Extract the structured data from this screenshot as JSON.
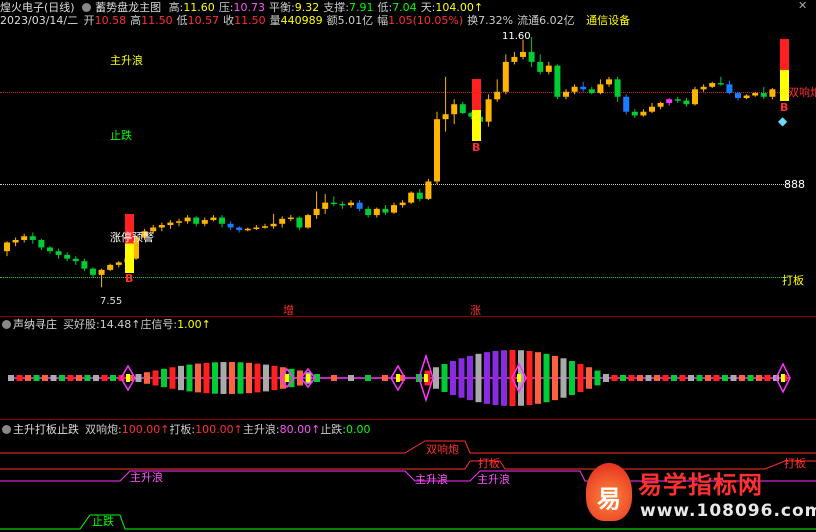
{
  "header": {
    "stock": "煌火电子(日线)",
    "indicator": "蓄势盘龙主图",
    "fields": [
      {
        "k": "高:",
        "v": "11.60",
        "c": "#ffff00"
      },
      {
        "k": "压:",
        "v": "10.73",
        "c": "#ff55ff"
      },
      {
        "k": "平衡:",
        "v": "9.32",
        "c": "#ffff00"
      },
      {
        "k": "支撑:",
        "v": "7.91",
        "c": "#00ff00"
      },
      {
        "k": "低:",
        "v": "7.04",
        "c": "#00ff00"
      },
      {
        "k": "天:",
        "v": "104.00↑",
        "c": "#ffff00"
      }
    ]
  },
  "header2": {
    "date": "2023/03/14/二",
    "fields": [
      {
        "k": "开",
        "v": "10.58",
        "c": "#ff3030"
      },
      {
        "k": "高",
        "v": "11.50",
        "c": "#ff3030"
      },
      {
        "k": "低",
        "v": "10.57",
        "c": "#ff3030"
      },
      {
        "k": "收",
        "v": "11.50",
        "c": "#ff3030"
      },
      {
        "k": "量",
        "v": "440989",
        "c": "#ffff00"
      },
      {
        "k": "额",
        "v": "5.01亿",
        "c": "#cccccc"
      },
      {
        "k": "幅",
        "v": "1.05(10.05%)",
        "c": "#ff3030"
      },
      {
        "k": "换",
        "v": "7.32%",
        "c": "#cccccc"
      },
      {
        "k": "流通",
        "v": "6.02亿",
        "c": "#cccccc"
      }
    ],
    "sector": "通信设备"
  },
  "main": {
    "labels": {
      "zhushenglang": "主升浪",
      "zhidie": "止跌",
      "zhangting": "涨停预警",
      "shuangxiangpao": "双响炮",
      "price888": "888",
      "daban": "打板",
      "high_mark": "11.60",
      "low_mark": "7.55",
      "zeng": "增",
      "zhang": "涨",
      "b": "B"
    },
    "candles": [
      [
        9.0,
        9.35,
        8.8,
        9.4
      ],
      [
        9.35,
        9.45,
        9.2,
        9.55
      ],
      [
        9.45,
        9.6,
        9.35,
        9.7
      ],
      [
        9.6,
        9.45,
        9.3,
        9.75
      ],
      [
        9.45,
        9.15,
        9.05,
        9.5
      ],
      [
        9.15,
        9.0,
        8.9,
        9.2
      ],
      [
        9.0,
        8.85,
        8.7,
        9.1
      ],
      [
        8.85,
        8.7,
        8.6,
        8.95
      ],
      [
        8.7,
        8.6,
        8.45,
        8.8
      ],
      [
        8.6,
        8.3,
        8.2,
        8.7
      ],
      [
        8.3,
        8.05,
        7.95,
        8.35
      ],
      [
        8.05,
        8.25,
        7.55,
        8.3
      ],
      [
        8.25,
        8.45,
        8.2,
        8.5
      ],
      [
        8.45,
        8.55,
        8.35,
        8.6
      ],
      [
        8.55,
        8.7,
        8.45,
        8.8
      ],
      [
        8.7,
        9.55,
        8.65,
        9.6
      ],
      [
        9.55,
        9.8,
        9.45,
        9.9
      ],
      [
        9.8,
        9.95,
        9.7,
        10.05
      ],
      [
        9.95,
        10.05,
        9.8,
        10.15
      ],
      [
        10.05,
        10.15,
        9.9,
        10.25
      ],
      [
        10.15,
        10.2,
        10.0,
        10.3
      ],
      [
        10.2,
        10.35,
        10.1,
        10.45
      ],
      [
        10.35,
        10.1,
        10.0,
        10.4
      ],
      [
        10.1,
        10.25,
        10.0,
        10.35
      ],
      [
        10.25,
        10.35,
        10.2,
        10.45
      ],
      [
        10.35,
        10.1,
        9.95,
        10.45
      ],
      [
        10.1,
        9.95,
        9.85,
        10.2
      ],
      [
        9.95,
        9.85,
        9.75,
        10.0
      ],
      [
        9.85,
        9.9,
        9.8,
        9.95
      ],
      [
        9.9,
        9.95,
        9.85,
        10.05
      ],
      [
        9.95,
        10.0,
        9.9,
        10.1
      ],
      [
        10.0,
        10.1,
        9.9,
        10.5
      ],
      [
        10.1,
        10.3,
        9.95,
        10.4
      ],
      [
        10.3,
        10.35,
        10.2,
        10.45
      ],
      [
        10.35,
        9.95,
        9.85,
        10.4
      ],
      [
        9.95,
        10.45,
        9.9,
        10.5
      ],
      [
        10.45,
        10.7,
        10.3,
        11.4
      ],
      [
        10.7,
        10.95,
        10.5,
        11.3
      ],
      [
        10.95,
        10.9,
        10.8,
        11.2
      ],
      [
        10.9,
        10.85,
        10.7,
        11.0
      ],
      [
        10.85,
        10.95,
        10.75,
        11.05
      ],
      [
        10.95,
        10.7,
        10.6,
        11.05
      ],
      [
        10.7,
        10.45,
        10.35,
        10.8
      ],
      [
        10.45,
        10.7,
        10.35,
        10.75
      ],
      [
        10.7,
        10.55,
        10.45,
        10.85
      ],
      [
        10.55,
        10.85,
        10.5,
        10.95
      ],
      [
        10.85,
        10.95,
        10.75,
        11.05
      ],
      [
        10.95,
        11.35,
        10.9,
        11.4
      ],
      [
        11.35,
        11.1,
        11.0,
        11.5
      ],
      [
        11.1,
        11.8,
        11.05,
        11.9
      ],
      [
        11.8,
        14.3,
        11.7,
        14.6
      ],
      [
        14.3,
        14.5,
        13.8,
        16.0
      ],
      [
        14.5,
        14.9,
        14.1,
        15.1
      ],
      [
        14.9,
        14.55,
        14.5,
        15.0
      ],
      [
        14.55,
        14.4,
        14.3,
        14.6
      ],
      [
        14.4,
        14.2,
        14.0,
        14.5
      ],
      [
        14.2,
        15.1,
        14.0,
        15.3
      ],
      [
        15.1,
        15.4,
        15.0,
        15.9
      ],
      [
        15.4,
        16.6,
        15.3,
        16.9
      ],
      [
        16.6,
        16.8,
        16.5,
        17.0
      ],
      [
        16.8,
        17.0,
        16.7,
        17.5
      ],
      [
        17.0,
        16.6,
        16.4,
        17.6
      ],
      [
        16.6,
        16.2,
        16.1,
        16.9
      ],
      [
        16.2,
        16.45,
        16.1,
        16.6
      ],
      [
        16.45,
        15.2,
        15.1,
        16.5
      ],
      [
        15.2,
        15.4,
        15.1,
        15.5
      ],
      [
        15.4,
        15.6,
        15.3,
        15.7
      ],
      [
        15.6,
        15.5,
        15.4,
        15.8
      ],
      [
        15.5,
        15.35,
        15.3,
        15.6
      ],
      [
        15.35,
        15.7,
        15.3,
        15.9
      ],
      [
        15.7,
        15.9,
        15.6,
        16.0
      ],
      [
        15.9,
        15.2,
        15.0,
        16.0
      ],
      [
        15.2,
        14.6,
        14.5,
        15.3
      ],
      [
        14.6,
        14.45,
        14.35,
        14.7
      ],
      [
        14.45,
        14.6,
        14.4,
        14.7
      ],
      [
        14.6,
        14.8,
        14.55,
        14.95
      ],
      [
        14.8,
        14.95,
        14.7,
        15.0
      ],
      [
        14.95,
        15.1,
        14.85,
        15.15
      ],
      [
        15.1,
        15.05,
        14.95,
        15.2
      ],
      [
        15.05,
        14.9,
        14.8,
        15.15
      ],
      [
        14.9,
        15.5,
        14.85,
        15.6
      ],
      [
        15.5,
        15.6,
        15.4,
        15.7
      ],
      [
        15.6,
        15.75,
        15.55,
        15.8
      ],
      [
        15.75,
        15.7,
        15.65,
        16.0
      ],
      [
        15.7,
        15.35,
        15.3,
        15.85
      ],
      [
        15.35,
        15.15,
        15.05,
        15.4
      ],
      [
        15.15,
        15.25,
        15.1,
        15.3
      ],
      [
        15.25,
        15.35,
        15.2,
        15.4
      ],
      [
        15.35,
        15.2,
        15.1,
        15.6
      ],
      [
        15.2,
        15.5,
        15.1,
        15.55
      ]
    ]
  },
  "pane2": {
    "title": "声纳寻庄",
    "fields": [
      {
        "k": "买好股:",
        "v": "14.48↑",
        "c": "#cccccc"
      },
      {
        "k": "庄信号:",
        "v": "1.00↑",
        "c": "#ffff00"
      }
    ]
  },
  "pane3": {
    "title": "主升打板止跌",
    "fields": [
      {
        "k": "双响炮:",
        "v": "100.00↑",
        "c": "#ff3030"
      },
      {
        "k": "打板:",
        "v": "100.00↑",
        "c": "#ff3030"
      },
      {
        "k": "主升浪:",
        "v": "80.00↑",
        "c": "#ff55ff"
      },
      {
        "k": "止跌:",
        "v": "0.00",
        "c": "#00ff00"
      }
    ],
    "labels": {
      "shuangxiangpao": "双响炮",
      "daban1": "打板",
      "daban2": "打板",
      "zhushenglang1": "主升浪",
      "zhushenglang2": "主升浪",
      "zhushenglang3": "主升浪",
      "zhidie": "止跌"
    }
  },
  "watermark": {
    "logo_char": "易",
    "name": "易学指标网",
    "url": "www.108096.com"
  },
  "colors": {
    "up": "#ffb400",
    "down": "#00cc33",
    "magenta": "#ff33ff",
    "blue": "#1a7cff",
    "red": "#ff2020"
  }
}
